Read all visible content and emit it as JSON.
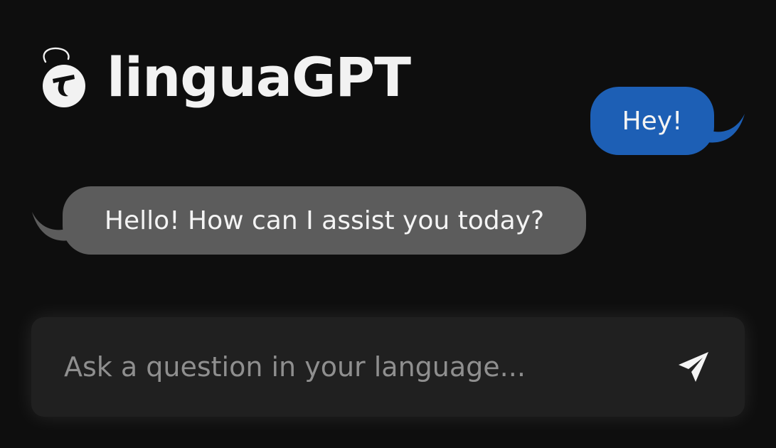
{
  "app": {
    "title": "linguaGPT"
  },
  "messages": [
    {
      "role": "user",
      "text": "Hey!"
    },
    {
      "role": "assistant",
      "text": "Hello! How can I assist you today?"
    }
  ],
  "composer": {
    "placeholder": "Ask a question in your language...",
    "value": "",
    "send_icon": "send-paper-plane-icon"
  },
  "colors": {
    "background": "#0e0e0e",
    "user_bubble": "#1d5fb5",
    "assistant_bubble": "#5c5c5c",
    "input_bar": "#202020",
    "text": "#f2f2f2",
    "placeholder": "#8f8f8f"
  }
}
